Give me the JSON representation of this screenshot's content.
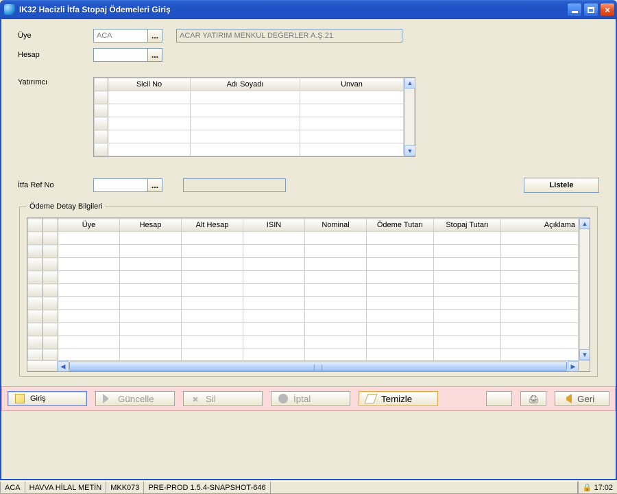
{
  "window": {
    "title": "IK32 Hacizli İtfa Stopaj Ödemeleri Giriş"
  },
  "form": {
    "uye_label": "Üye",
    "uye_value": "ACA",
    "uye_desc": "ACAR YATIRIM MENKUL DEĞERLER A.Ş.21",
    "hesap_label": "Hesap",
    "hesap_value": "",
    "yatirimci_label": "Yatırımcı",
    "itfaref_label": "İtfa Ref No",
    "itfaref_value": "",
    "itfaref_readonly": "",
    "listele_label": "Listele"
  },
  "grid1": {
    "columns": [
      "Sicil No",
      "Adı Soyadı",
      "Unvan"
    ]
  },
  "detail_title": "Ödeme Detay Bilgileri",
  "grid2": {
    "columns": [
      "Üye",
      "Hesap",
      "Alt Hesap",
      "ISIN",
      "Nominal",
      "Ödeme Tutarı",
      "Stopaj Tutarı",
      "Açıklama"
    ]
  },
  "actions": {
    "giris": "Giriş",
    "guncelle": "Güncelle",
    "sil": "Sil",
    "iptal": "İptal",
    "temizle": "Temizle",
    "geri": "Geri"
  },
  "status": {
    "c1": "ACA",
    "c2": "HAVVA HİLAL METİN",
    "c3": "MKK073",
    "c4": "PRE-PROD 1.5.4-SNAPSHOT-646",
    "time": "17:02"
  }
}
